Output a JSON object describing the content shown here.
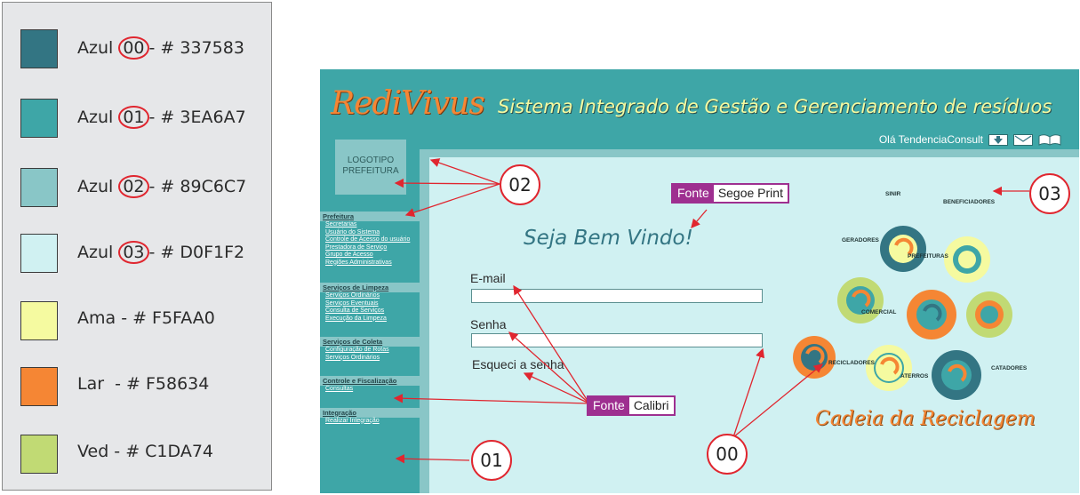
{
  "palette": [
    {
      "name": "Azul ",
      "code": "00",
      "hex_text": "- # 337583",
      "color": "#337583"
    },
    {
      "name": "Azul ",
      "code": "01",
      "hex_text": "- # 3EA6A7",
      "color": "#3ea6a7"
    },
    {
      "name": "Azul ",
      "code": "02",
      "hex_text": "- # 89C6C7",
      "color": "#89c6c7"
    },
    {
      "name": "Azul ",
      "code": "03",
      "hex_text": "- # D0F1F2",
      "color": "#d0f1f2"
    },
    {
      "name": "Ama - # F5FAA0",
      "code": "",
      "hex_text": "",
      "color": "#f5faa0"
    },
    {
      "name": "Lar  - # F58634",
      "code": "",
      "hex_text": "",
      "color": "#f58634"
    },
    {
      "name": "Ved - # C1DA74",
      "code": "",
      "hex_text": "",
      "color": "#c1da74"
    }
  ],
  "app": {
    "logo": "RediVivus",
    "title": "Sistema Integrado de Gestão e Gerenciamento de resíduos",
    "greeting": "Olá TendenciaConsult",
    "logo_box_line1": "LOGOTIPO",
    "logo_box_line2": "PREFEITURA",
    "welcome": "Seja Bem Vindo!",
    "email_label": "E-mail",
    "password_label": "Senha",
    "forgot_link": "Esqueci a senha",
    "cycle_title": "Cadeia da Reciclagem",
    "icons": [
      "download-icon",
      "mail-icon",
      "book-icon"
    ]
  },
  "sidebar": [
    {
      "title": "Prefeitura",
      "items": [
        "Secretarias",
        "Usuário do Sistema",
        "Controle de Acesso do usuário",
        "Prestadora de Serviço",
        "Grupo de Acesso",
        "Regiões Administrativas"
      ]
    },
    {
      "title": "Serviços de Limpeza",
      "items": [
        "Serviços Ordinários",
        "Serviços Eventuais",
        "Consulta de Serviços",
        "Execução da Limpeza"
      ]
    },
    {
      "title": "Serviços de Coleta",
      "items": [
        "Configuração de Rotas",
        "Serviços Ordinários"
      ]
    },
    {
      "title": "Controle e Fiscalização",
      "items": [
        "Consultas"
      ]
    },
    {
      "title": "Integração",
      "items": [
        "Realizar Integração"
      ]
    }
  ],
  "gear_labels": [
    "SINIR",
    "BENEFICIADORES",
    "GERADORES",
    "PREFEITURAS",
    "COMERCIAL",
    "RECICLADORES",
    "ATERROS",
    "CATADORES"
  ],
  "annotations": {
    "circle_02": "02",
    "circle_03": "03",
    "circle_01": "01",
    "circle_00": "00",
    "font_tag_1_a": "Fonte",
    "font_tag_1_b": "Segoe Print",
    "font_tag_2_a": "Fonte",
    "font_tag_2_b": "Calibri"
  },
  "colors": {
    "azul00": "#337583",
    "azul01": "#3ea6a7",
    "azul02": "#89c6c7",
    "azul03": "#d0f1f2",
    "ama": "#f5faa0",
    "lar": "#f58634",
    "ved": "#c1da74",
    "annotation_red": "#e0262f",
    "tag_purple": "#9e2f90"
  }
}
